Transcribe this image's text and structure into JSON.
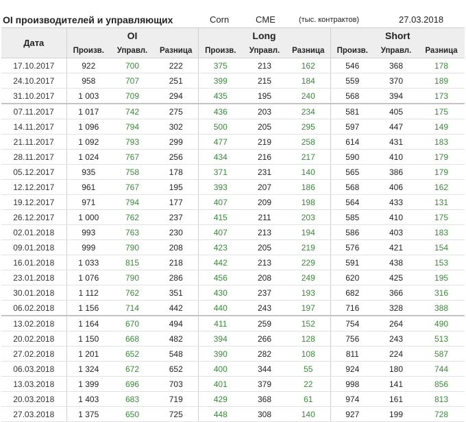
{
  "header": {
    "title": "OI производителей и управляющих",
    "commodity": "Corn",
    "exchange": "CME",
    "unit": "(тыс. контрактов)",
    "date": "27.03.2018"
  },
  "table": {
    "date_header": "Дата",
    "groups": [
      "OI",
      "Long",
      "Short"
    ],
    "subheaders": [
      "Произв.",
      "Управл.",
      "Разница",
      "Произв.",
      "Управл.",
      "Разница",
      "Произв.",
      "Управл.",
      "Разница"
    ],
    "green_color": "#3a8a3a",
    "rows": [
      [
        "17.10.2017",
        "922",
        "700",
        "222",
        "375",
        "213",
        "162",
        "546",
        "368",
        "178"
      ],
      [
        "24.10.2017",
        "958",
        "707",
        "251",
        "399",
        "215",
        "184",
        "559",
        "370",
        "189"
      ],
      [
        "31.10.2017",
        "1 003",
        "709",
        "294",
        "435",
        "195",
        "240",
        "568",
        "394",
        "173"
      ],
      [
        "07.11.2017",
        "1 017",
        "742",
        "275",
        "436",
        "203",
        "234",
        "581",
        "405",
        "175"
      ],
      [
        "14.11.2017",
        "1 096",
        "794",
        "302",
        "500",
        "205",
        "295",
        "597",
        "447",
        "149"
      ],
      [
        "21.11.2017",
        "1 092",
        "793",
        "299",
        "477",
        "219",
        "258",
        "614",
        "431",
        "183"
      ],
      [
        "28.11.2017",
        "1 024",
        "767",
        "256",
        "434",
        "216",
        "217",
        "590",
        "410",
        "179"
      ],
      [
        "05.12.2017",
        "935",
        "758",
        "178",
        "371",
        "231",
        "140",
        "565",
        "386",
        "179"
      ],
      [
        "12.12.2017",
        "961",
        "767",
        "195",
        "393",
        "207",
        "186",
        "568",
        "406",
        "162"
      ],
      [
        "19.12.2017",
        "971",
        "794",
        "177",
        "407",
        "209",
        "198",
        "564",
        "433",
        "131"
      ],
      [
        "26.12.2017",
        "1 000",
        "762",
        "237",
        "415",
        "211",
        "203",
        "585",
        "410",
        "175"
      ],
      [
        "02.01.2018",
        "993",
        "763",
        "230",
        "407",
        "213",
        "194",
        "586",
        "403",
        "183"
      ],
      [
        "09.01.2018",
        "999",
        "790",
        "208",
        "423",
        "205",
        "219",
        "576",
        "421",
        "154"
      ],
      [
        "16.01.2018",
        "1 033",
        "815",
        "218",
        "442",
        "213",
        "229",
        "591",
        "438",
        "153"
      ],
      [
        "23.01.2018",
        "1 076",
        "790",
        "286",
        "456",
        "208",
        "249",
        "620",
        "425",
        "195"
      ],
      [
        "30.01.2018",
        "1 112",
        "762",
        "351",
        "430",
        "237",
        "193",
        "682",
        "366",
        "316"
      ],
      [
        "06.02.2018",
        "1 156",
        "714",
        "442",
        "440",
        "243",
        "197",
        "716",
        "328",
        "388"
      ],
      [
        "13.02.2018",
        "1 164",
        "670",
        "494",
        "411",
        "259",
        "152",
        "754",
        "264",
        "490"
      ],
      [
        "20.02.2018",
        "1 150",
        "668",
        "482",
        "394",
        "266",
        "128",
        "756",
        "243",
        "513"
      ],
      [
        "27.02.2018",
        "1 201",
        "652",
        "548",
        "390",
        "282",
        "108",
        "811",
        "224",
        "587"
      ],
      [
        "06.03.2018",
        "1 324",
        "672",
        "652",
        "400",
        "344",
        "55",
        "924",
        "180",
        "744"
      ],
      [
        "13.03.2018",
        "1 399",
        "696",
        "703",
        "401",
        "379",
        "22",
        "998",
        "141",
        "856"
      ],
      [
        "20.03.2018",
        "1 403",
        "683",
        "719",
        "429",
        "368",
        "61",
        "974",
        "161",
        "813"
      ],
      [
        "27.03.2018",
        "1 375",
        "650",
        "725",
        "448",
        "308",
        "140",
        "927",
        "199",
        "728"
      ]
    ]
  }
}
